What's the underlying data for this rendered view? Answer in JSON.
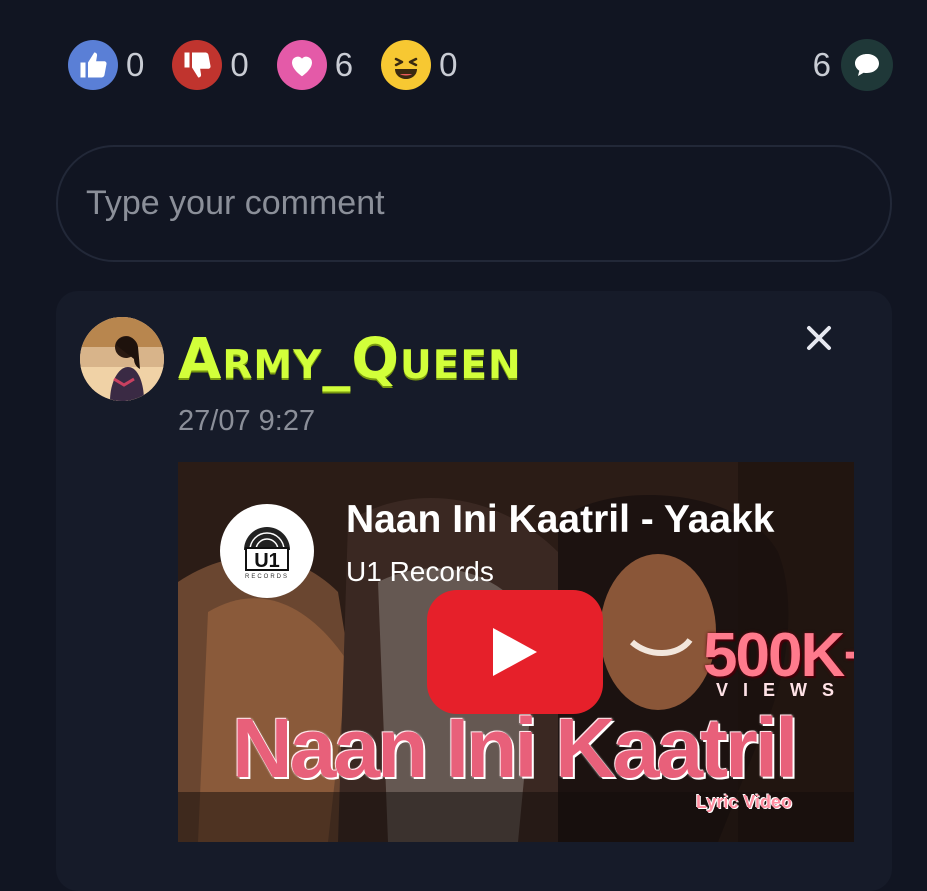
{
  "reactions": [
    {
      "name": "like",
      "icon": "thumbs-up-icon",
      "count": "0",
      "color": "#5a7fd6"
    },
    {
      "name": "dislike",
      "icon": "thumbs-down-icon",
      "count": "0",
      "color": "#c0342e"
    },
    {
      "name": "love",
      "icon": "heart-icon",
      "count": "6",
      "color": "#e45aa8"
    },
    {
      "name": "laugh",
      "icon": "laughing-face-icon",
      "count": "0",
      "color": "#f7c832"
    }
  ],
  "comments": {
    "count": "6",
    "icon": "speech-bubble-icon",
    "color": "#1f3838"
  },
  "comment_input": {
    "placeholder": "Type your comment"
  },
  "comment": {
    "username": "Army_Queen",
    "timestamp": "27/07 9:27",
    "username_color": "#d2ff3a",
    "close_icon": "close-icon",
    "video": {
      "title": "Naan Ini Kaatril - Yaakk",
      "channel": "U1 Records",
      "logo_text": "U1",
      "logo_sub": "RECORDS",
      "thumbnail_views": "500K+",
      "thumbnail_views_label": "VIEWS",
      "thumbnail_title": "Naan Ini Kaatril",
      "thumbnail_subtitle": "Lyric Video",
      "play_icon": "play-icon"
    }
  }
}
